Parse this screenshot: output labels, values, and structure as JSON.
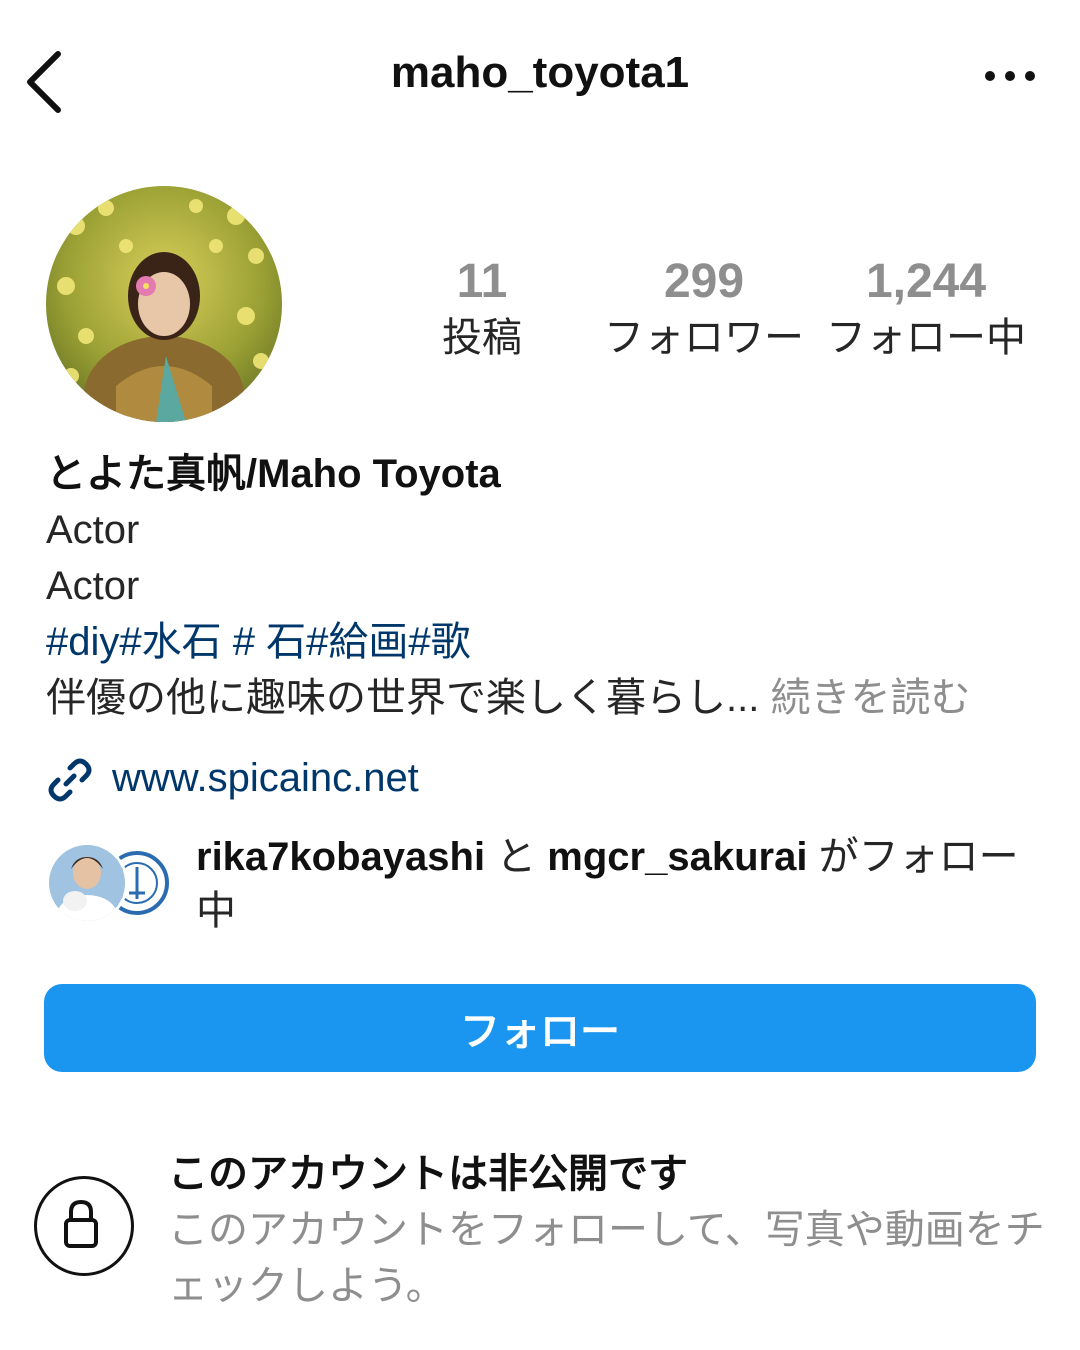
{
  "header": {
    "username": "maho_toyota1",
    "back_icon": "chevron-left-icon",
    "more_icon": "more-horizontal-icon"
  },
  "stats": {
    "posts": {
      "count": "11",
      "label": "投稿"
    },
    "followers": {
      "count": "299",
      "label": "フォロワー"
    },
    "following": {
      "count": "1,244",
      "label": "フォロー中"
    }
  },
  "bio": {
    "name": "とよた真帆/Maho Toyota",
    "line1": "Actor",
    "line2": "Actor",
    "hashtags": "#diy#水石 # 石#給画#歌",
    "description": "伴優の他に趣味の世界で楽しく暮らし...",
    "more_label": " 続きを読む",
    "link": "www.spicainc.net"
  },
  "followed_by": {
    "user1": "rika7kobayashi",
    "connector": " と ",
    "user2": "mgcr_sakurai",
    "suffix": " がフォロー中"
  },
  "follow_button": {
    "label": "フォロー"
  },
  "private": {
    "title": "このアカウントは非公開です",
    "description": "このアカウントをフォローして、写真や動画をチェックしよう。"
  },
  "colors": {
    "follow_button": "#1a96f0",
    "link": "#00376b",
    "muted": "#8e8e8e"
  }
}
